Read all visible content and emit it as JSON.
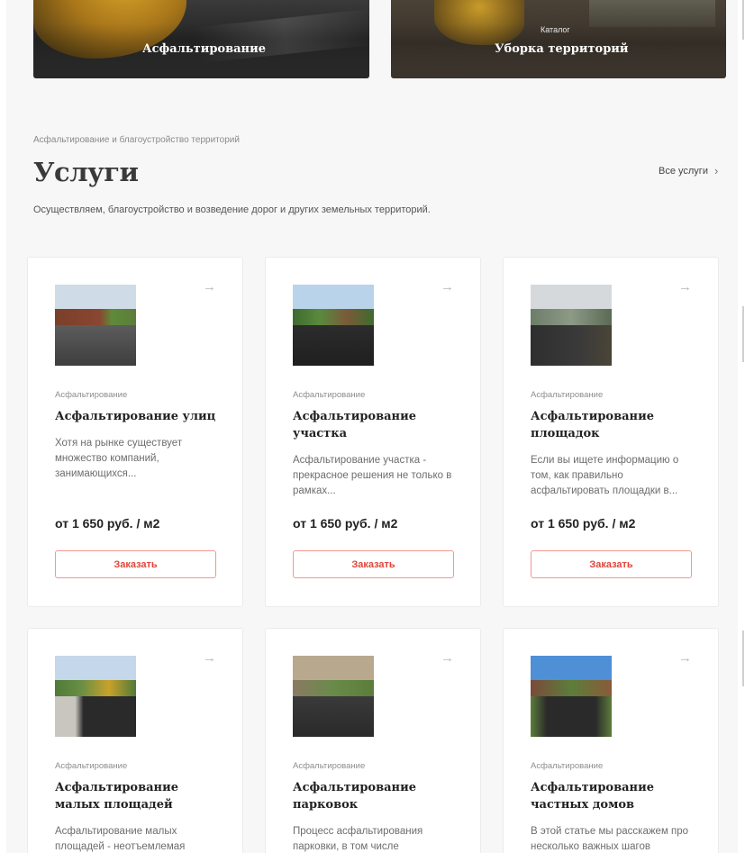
{
  "top_tiles": [
    {
      "title": "Асфальтирование"
    },
    {
      "kicker": "Каталог",
      "title": "Уборка территорий"
    }
  ],
  "section": {
    "breadcrumb": "Асфальтирование и благоустройство территорий",
    "title": "Услуги",
    "all_link": "Все услуги",
    "lead": "Осуществляем, благоустройство и возведение дорог и других земельных территорий."
  },
  "services": [
    {
      "category": "Асфальтирование",
      "title": "Асфальтирование улиц",
      "description": "Хотя на рынке существует множество компаний, занимающихся...",
      "price": "от 1 650 руб. / м2",
      "button": "Заказать"
    },
    {
      "category": "Асфальтирование",
      "title": "Асфальтирование участка",
      "description": "Асфальтирование участка - прекрасное решения не только в рамках...",
      "price": "от 1 650 руб. / м2",
      "button": "Заказать"
    },
    {
      "category": "Асфальтирование",
      "title": "Асфальтирование площадок",
      "description": "Если вы ищете информацию о том, как правильно асфальтировать площадки в...",
      "price": "от 1 650 руб. / м2",
      "button": "Заказать"
    },
    {
      "category": "Асфальтирование",
      "title": "Асфальтирование малых площадей",
      "description": "Асфальтирование малых площадей - неотъемлемая"
    },
    {
      "category": "Асфальтирование",
      "title": "Асфальтирование парковок",
      "description": "Процесс асфальтирования парковки, в том числе"
    },
    {
      "category": "Асфальтирование",
      "title": "Асфальтирование частных домов",
      "description": "В этой статье мы расскажем про несколько важных шагов"
    }
  ],
  "icons": {
    "card_arrow": "arrow-right-icon",
    "all_link_chevron": "chevron-right-icon"
  }
}
